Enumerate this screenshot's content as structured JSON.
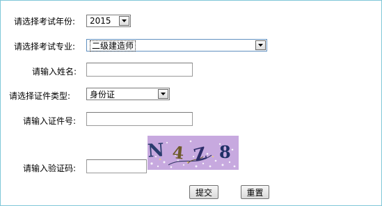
{
  "form": {
    "exam_year": {
      "label": "请选择考试年份:",
      "selected": "2015"
    },
    "exam_major": {
      "label": "请选择考试专业:",
      "selected": "二级建造师"
    },
    "name": {
      "label": "请输入姓名:",
      "value": ""
    },
    "id_type": {
      "label": "请选择证件类型:",
      "selected": "身份证"
    },
    "id_number": {
      "label": "请输入证件号:",
      "value": ""
    },
    "captcha": {
      "label": "请输入验证码:",
      "value": "",
      "image_text": "N4Z8"
    },
    "submit_label": "提交",
    "reset_label": "重置"
  },
  "colors": {
    "panel_border": "#7fc7d8",
    "captcha_bg": "#c7a9df"
  },
  "icons": {
    "select_arrow": "chevron-down-icon"
  }
}
